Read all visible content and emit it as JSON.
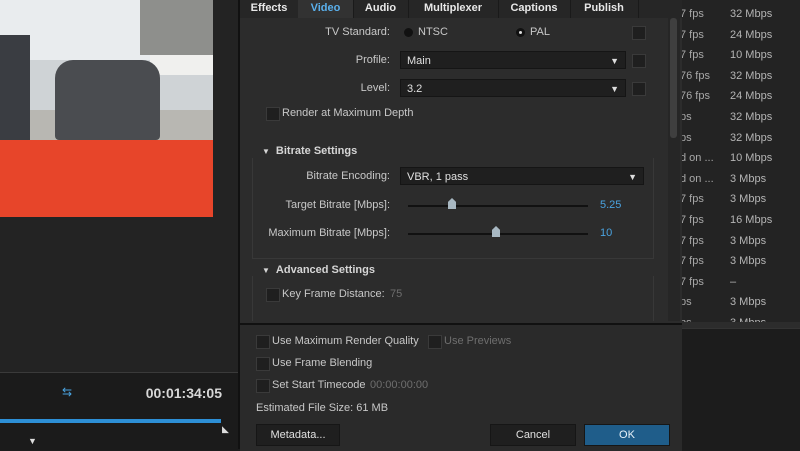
{
  "preview": {
    "timecode": "00:01:34:05",
    "progress": 0.98
  },
  "tabs": [
    "Effects",
    "Video",
    "Audio",
    "Multiplexer",
    "Captions",
    "Publish"
  ],
  "active_tab": "Video",
  "video": {
    "tv_standard_label": "TV Standard:",
    "ntsc": "NTSC",
    "pal": "PAL",
    "profile_label": "Profile:",
    "profile_value": "Main",
    "level_label": "Level:",
    "level_value": "3.2",
    "render_max_depth": "Render at Maximum Depth"
  },
  "bitrate": {
    "header": "Bitrate Settings",
    "encoding_label": "Bitrate Encoding:",
    "encoding_value": "VBR, 1 pass",
    "target_label": "Target Bitrate [Mbps]:",
    "target_value": "5.25",
    "max_label": "Maximum Bitrate [Mbps]:",
    "max_value": "10"
  },
  "advanced": {
    "header": "Advanced Settings",
    "keyframe_label": "Key Frame Distance:",
    "keyframe_value": "75"
  },
  "options": {
    "max_render_quality": "Use Maximum Render Quality",
    "use_previews": "Use Previews",
    "frame_blending": "Use Frame Blending",
    "start_timecode": "Set Start Timecode",
    "start_timecode_value": "00:00:00:00",
    "file_size": "Estimated File Size:  61 MB"
  },
  "buttons": {
    "metadata": "Metadata...",
    "cancel": "Cancel",
    "ok": "OK"
  },
  "queue_rows": [
    {
      "a": "7 fps",
      "b": "32 Mbps"
    },
    {
      "a": "7 fps",
      "b": "24 Mbps"
    },
    {
      "a": "7 fps",
      "b": "10 Mbps"
    },
    {
      "a": "76 fps",
      "b": "32 Mbps"
    },
    {
      "a": "76 fps",
      "b": "24 Mbps"
    },
    {
      "a": "ps",
      "b": "32 Mbps"
    },
    {
      "a": "ps",
      "b": "32 Mbps"
    },
    {
      "a": "d on ...",
      "b": "10 Mbps"
    },
    {
      "a": "d on ...",
      "b": "3 Mbps"
    },
    {
      "a": "7 fps",
      "b": "3 Mbps"
    },
    {
      "a": "7 fps",
      "b": "16 Mbps"
    },
    {
      "a": "7 fps",
      "b": "3 Mbps"
    },
    {
      "a": "7 fps",
      "b": "3 Mbps"
    },
    {
      "a": "7 fps",
      "b": "–"
    },
    {
      "a": "ps",
      "b": "3 Mbps"
    },
    {
      "a": "ps",
      "b": "3 Mbps"
    }
  ]
}
